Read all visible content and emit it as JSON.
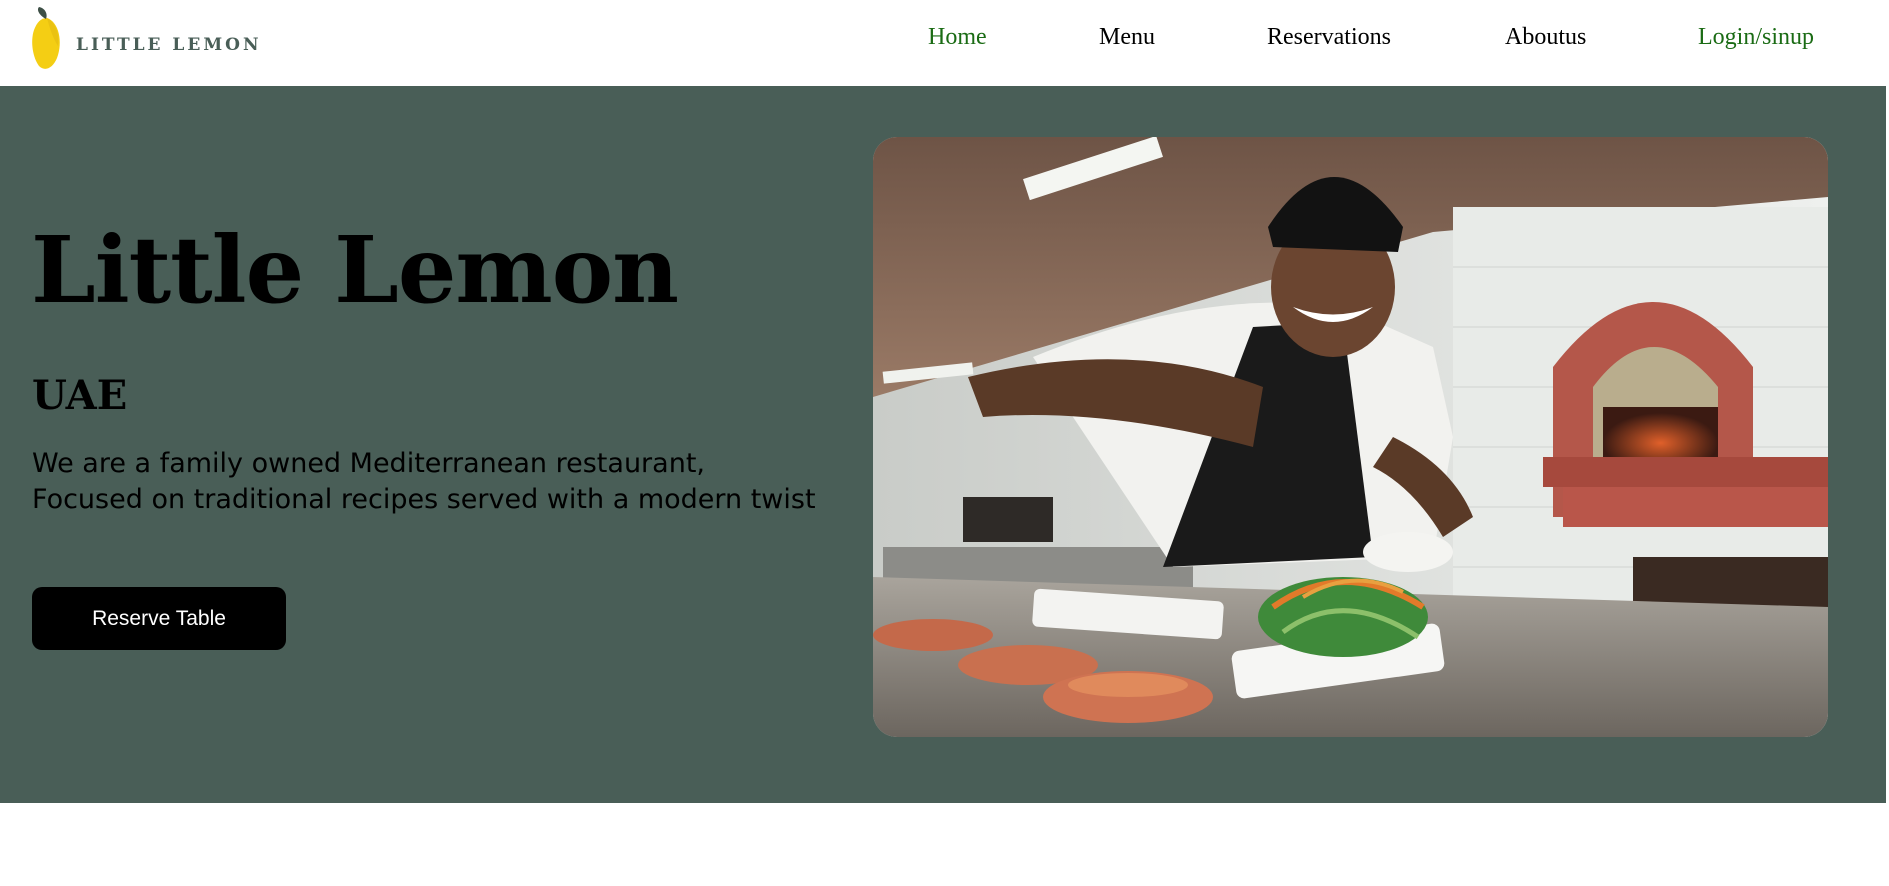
{
  "brand": {
    "logo_icon": "lemon-icon",
    "name": "LITTLE LEMON",
    "colors": {
      "primary_green": "#495e57",
      "lemon_yellow": "#f4ce14",
      "nav_active_green": "#1a6b14",
      "button_black": "#000000"
    }
  },
  "nav": {
    "items": [
      {
        "label": "Home"
      },
      {
        "label": "Menu"
      },
      {
        "label": "Reservations"
      },
      {
        "label": "Aboutus"
      },
      {
        "label": "Login/sinup"
      }
    ]
  },
  "hero": {
    "title": "Little Lemon",
    "subtitle": "UAE",
    "description": "We are a family owned Mediterranean restaurant, Focused on traditional recipes served with a modern twist",
    "button_label": "Reserve Table",
    "image_subject": "chef-plating-salad-photo"
  }
}
